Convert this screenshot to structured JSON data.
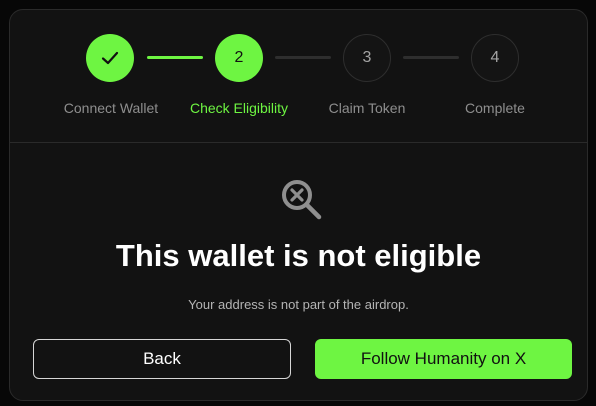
{
  "stepper": {
    "steps": [
      {
        "label": "Connect Wallet",
        "number": "",
        "state": "done"
      },
      {
        "label": "Check Eligibility",
        "number": "2",
        "state": "active"
      },
      {
        "label": "Claim Token",
        "number": "3",
        "state": "pending"
      },
      {
        "label": "Complete",
        "number": "4",
        "state": "pending"
      }
    ]
  },
  "result": {
    "icon": "search-x-icon",
    "title": "This wallet is not eligible",
    "message": "Your address is not part of the airdrop."
  },
  "actions": {
    "back_label": "Back",
    "follow_label": "Follow Humanity on X"
  },
  "colors": {
    "accent": "#6ef542",
    "background": "#121212",
    "muted_text": "#8e8e8e"
  }
}
